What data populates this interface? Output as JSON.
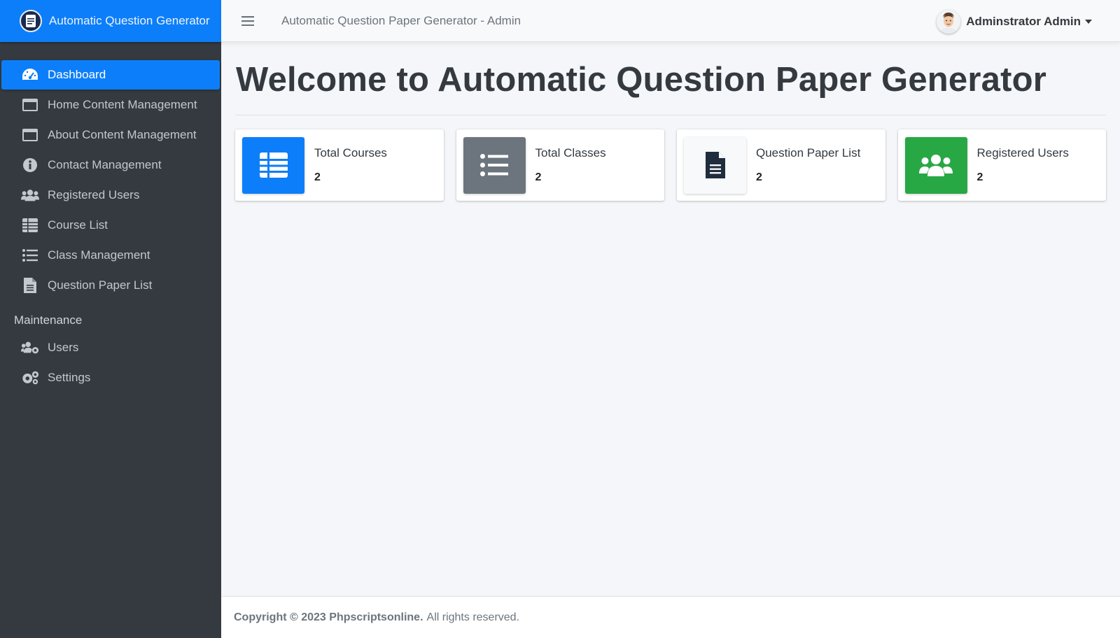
{
  "brand": {
    "title": "Automatic Question Generator"
  },
  "topbar": {
    "title": "Automatic Question Paper Generator - Admin",
    "user_name": "Adminstrator Admin"
  },
  "sidebar": {
    "items": [
      {
        "label": "Dashboard",
        "icon": "tachometer-icon",
        "active": true
      },
      {
        "label": "Home Content Management",
        "icon": "window-icon"
      },
      {
        "label": "About Content Management",
        "icon": "window-icon"
      },
      {
        "label": "Contact Management",
        "icon": "info-circle-icon"
      },
      {
        "label": "Registered Users",
        "icon": "users-icon"
      },
      {
        "label": "Course List",
        "icon": "table-icon"
      },
      {
        "label": "Class Management",
        "icon": "list-icon"
      },
      {
        "label": "Question Paper List",
        "icon": "file-icon"
      }
    ],
    "maintenance_header": "Maintenance",
    "maintenance_items": [
      {
        "label": "Users",
        "icon": "users-cog-icon"
      },
      {
        "label": "Settings",
        "icon": "cogs-icon"
      }
    ]
  },
  "main": {
    "title": "Welcome to Automatic Question Paper Generator",
    "cards": [
      {
        "label": "Total Courses",
        "value": "2",
        "color": "#0d7ef9",
        "icon": "table-icon"
      },
      {
        "label": "Total Classes",
        "value": "2",
        "color": "#6c757d",
        "icon": "list-icon"
      },
      {
        "label": "Question Paper List",
        "value": "2",
        "color": "#f8f9fa",
        "icon": "file-icon"
      },
      {
        "label": "Registered Users",
        "value": "2",
        "color": "#28a745",
        "icon": "users-icon"
      }
    ]
  },
  "footer": {
    "copyright": "Copyright © 2023 Phpscriptsonline.",
    "rights": "All rights reserved."
  },
  "colors": {
    "primary": "#0d7ef9",
    "sidebar_bg": "#343a40",
    "success": "#28a745",
    "secondary": "#6c757d"
  }
}
